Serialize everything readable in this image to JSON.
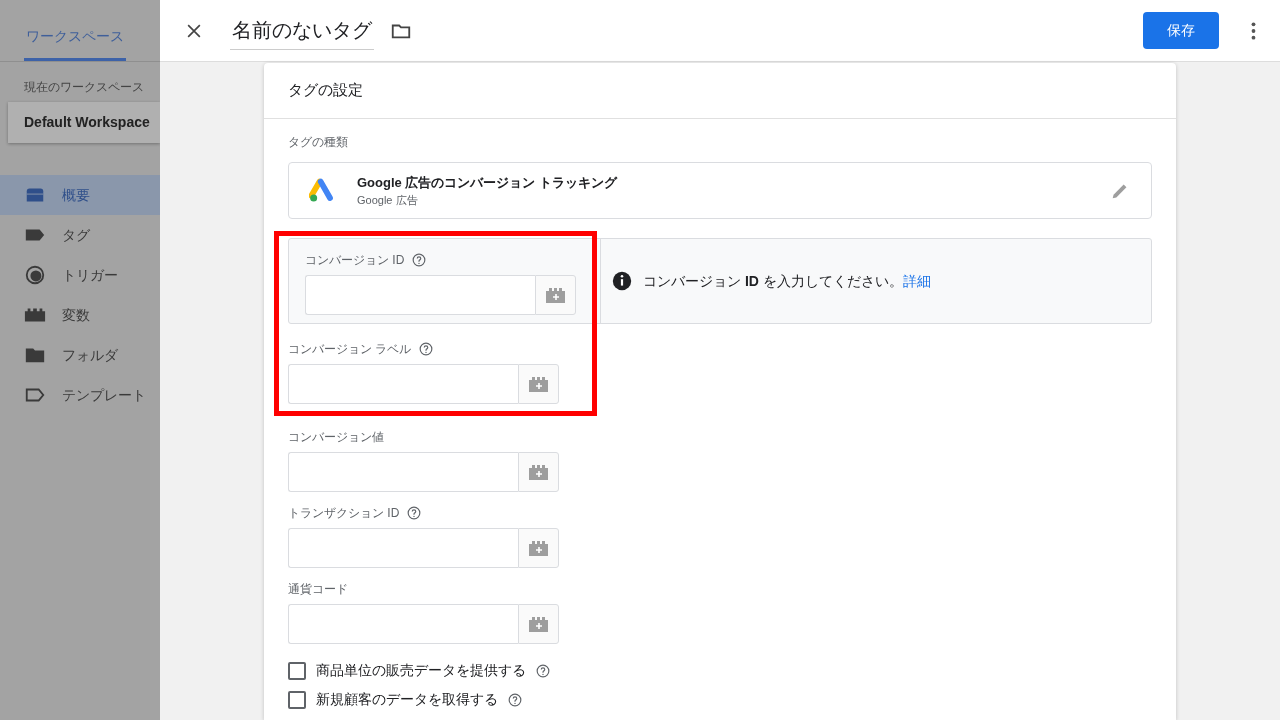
{
  "sidebar": {
    "tab": "ワークスペース",
    "workspace_label": "現在のワークスペース",
    "workspace": "Default Workspace",
    "items": [
      {
        "label": "概要",
        "selected": true
      },
      {
        "label": "タグ",
        "selected": false
      },
      {
        "label": "トリガー",
        "selected": false
      },
      {
        "label": "変数",
        "selected": false
      },
      {
        "label": "フォルダ",
        "selected": false
      },
      {
        "label": "テンプレート",
        "selected": false
      }
    ]
  },
  "header": {
    "title": "名前のないタグ",
    "save": "保存"
  },
  "card": {
    "title": "タグの設定",
    "type_label": "タグの種類",
    "tag_type": {
      "name": "Google 広告のコンバージョン トラッキング",
      "sub": "Google 広告"
    },
    "fields": [
      {
        "kind": "panel",
        "label": "コンバージョン ID",
        "help": true,
        "message": "コンバージョン **ID** を入力してください。",
        "link": "詳細"
      },
      {
        "kind": "plain",
        "label": "コンバージョン ラベル",
        "help": true
      },
      {
        "kind": "plain",
        "label": "コンバージョン値",
        "help": false
      },
      {
        "kind": "plain",
        "label": "トランザクション ID",
        "help": true
      },
      {
        "kind": "plain",
        "label": "通貨コード",
        "help": false
      }
    ],
    "checkboxes": [
      {
        "label": "商品単位の販売データを提供する",
        "checked": false,
        "help": true
      },
      {
        "label": "新規顧客のデータを取得する",
        "checked": false,
        "help": true
      }
    ]
  }
}
